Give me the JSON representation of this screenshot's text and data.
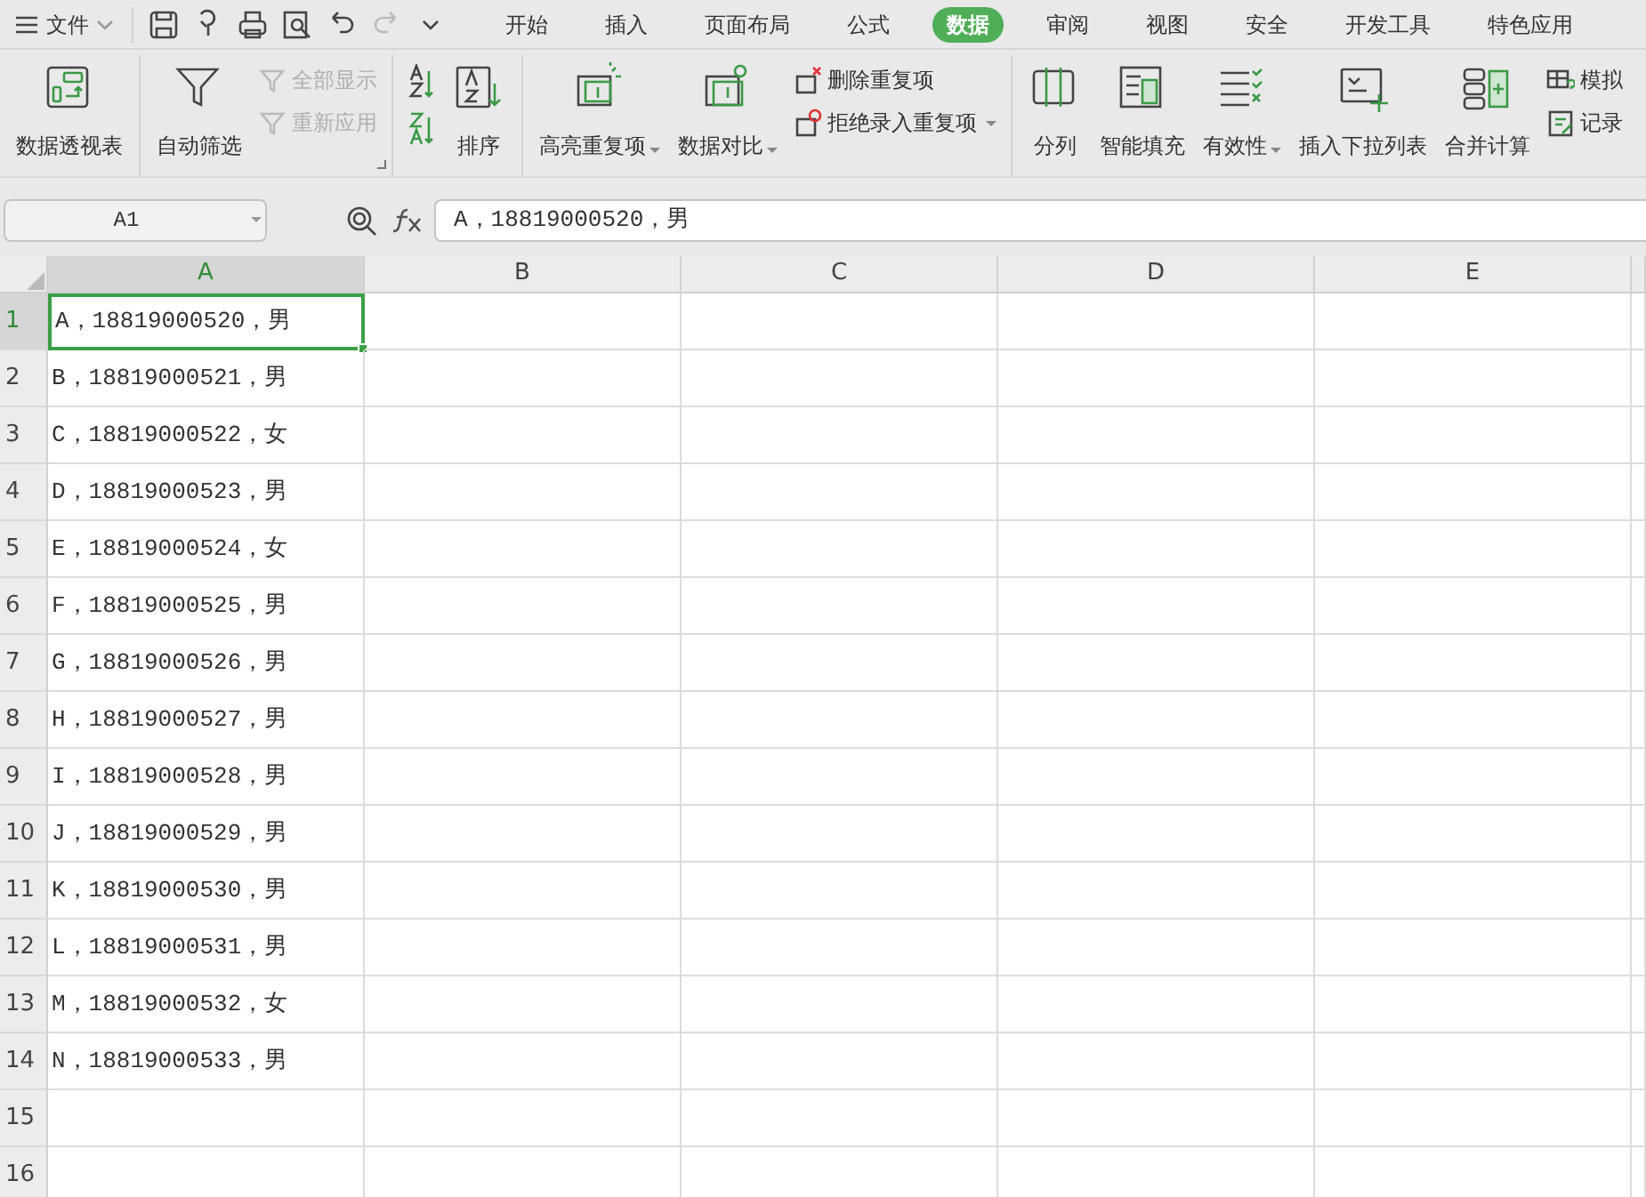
{
  "menu": {
    "label": "文件"
  },
  "tabs": [
    {
      "label": "开始",
      "selected": false
    },
    {
      "label": "插入",
      "selected": false
    },
    {
      "label": "页面布局",
      "selected": false
    },
    {
      "label": "公式",
      "selected": false
    },
    {
      "label": "数据",
      "selected": true
    },
    {
      "label": "审阅",
      "selected": false
    },
    {
      "label": "视图",
      "selected": false
    },
    {
      "label": "安全",
      "selected": false
    },
    {
      "label": "开发工具",
      "selected": false
    },
    {
      "label": "特色应用",
      "selected": false
    }
  ],
  "ribbon": [
    {
      "items": [
        {
          "kind": "large",
          "label": "数据透视表",
          "dropdown": false,
          "disabled": false
        }
      ]
    },
    {
      "items": [
        {
          "kind": "large",
          "label": "自动筛选",
          "dropdown": false,
          "disabled": false
        },
        {
          "kind": "stack",
          "items": [
            {
              "label": "全部显示",
              "dropdown": false,
              "disabled": true
            },
            {
              "label": "重新应用",
              "dropdown": false,
              "disabled": true
            }
          ]
        }
      ]
    },
    {
      "items": [
        {
          "kind": "iconstack"
        },
        {
          "kind": "large",
          "label": "排序",
          "dropdown": false,
          "disabled": false
        }
      ]
    },
    {
      "items": [
        {
          "kind": "large",
          "label": "高亮重复项",
          "dropdown": true,
          "disabled": false
        },
        {
          "kind": "large",
          "label": "数据对比",
          "dropdown": true,
          "disabled": false
        },
        {
          "kind": "stack",
          "items": [
            {
              "label": "删除重复项",
              "dropdown": false,
              "disabled": false
            },
            {
              "label": "拒绝录入重复项",
              "dropdown": true,
              "disabled": false
            }
          ]
        }
      ]
    },
    {
      "items": [
        {
          "kind": "large",
          "label": "分列",
          "dropdown": false,
          "disabled": false
        },
        {
          "kind": "large",
          "label": "智能填充",
          "dropdown": false,
          "disabled": false
        },
        {
          "kind": "large",
          "label": "有效性",
          "dropdown": true,
          "disabled": false
        },
        {
          "kind": "large",
          "label": "插入下拉列表",
          "dropdown": false,
          "disabled": false
        },
        {
          "kind": "large",
          "label": "合并计算",
          "dropdown": false,
          "disabled": false
        },
        {
          "kind": "stack",
          "items": [
            {
              "label": "模拟",
              "dropdown": false,
              "disabled": false
            },
            {
              "label": "记录",
              "dropdown": false,
              "disabled": false
            }
          ]
        }
      ]
    }
  ],
  "name_box": "A1",
  "formula": "A，18819000520，男",
  "columns": [
    {
      "label": "A",
      "selected": true
    },
    {
      "label": "B",
      "selected": false
    },
    {
      "label": "C",
      "selected": false
    },
    {
      "label": "D",
      "selected": false
    },
    {
      "label": "E",
      "selected": false
    }
  ],
  "rows": [
    {
      "number": "1",
      "selected": true,
      "cells": [
        "A，18819000520，男"
      ]
    },
    {
      "number": "2",
      "selected": false,
      "cells": [
        "B，18819000521，男"
      ]
    },
    {
      "number": "3",
      "selected": false,
      "cells": [
        "C，18819000522，女"
      ]
    },
    {
      "number": "4",
      "selected": false,
      "cells": [
        "D，18819000523，男"
      ]
    },
    {
      "number": "5",
      "selected": false,
      "cells": [
        "E，18819000524，女"
      ]
    },
    {
      "number": "6",
      "selected": false,
      "cells": [
        "F，18819000525，男"
      ]
    },
    {
      "number": "7",
      "selected": false,
      "cells": [
        "G，18819000526，男"
      ]
    },
    {
      "number": "8",
      "selected": false,
      "cells": [
        "H，18819000527，男"
      ]
    },
    {
      "number": "9",
      "selected": false,
      "cells": [
        "I，18819000528，男"
      ]
    },
    {
      "number": "10",
      "selected": false,
      "cells": [
        "J，18819000529，男"
      ]
    },
    {
      "number": "11",
      "selected": false,
      "cells": [
        "K，18819000530，男"
      ]
    },
    {
      "number": "12",
      "selected": false,
      "cells": [
        "L，18819000531，男"
      ]
    },
    {
      "number": "13",
      "selected": false,
      "cells": [
        "M，18819000532，女"
      ]
    },
    {
      "number": "14",
      "selected": false,
      "cells": [
        "N，18819000533，男"
      ]
    },
    {
      "number": "15",
      "selected": false,
      "cells": []
    },
    {
      "number": "16",
      "selected": false,
      "cells": []
    }
  ]
}
